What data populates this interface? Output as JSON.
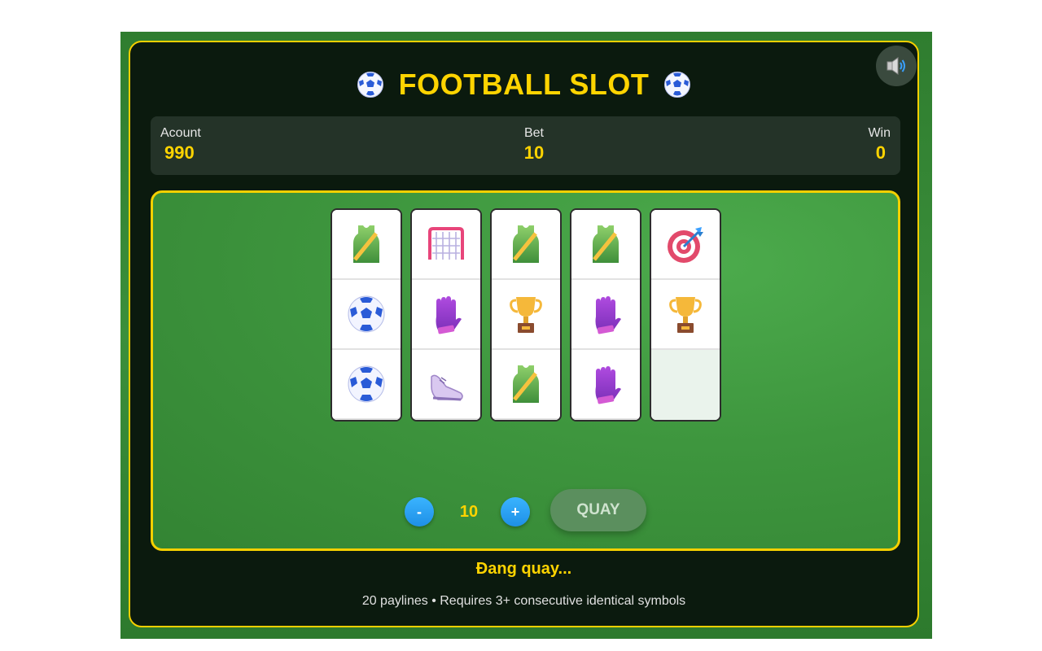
{
  "header": {
    "title": "FOOTBALL SLOT",
    "title_icon": "soccer-ball-icon",
    "sound_icon": "speaker-icon"
  },
  "stats": {
    "account_label": "Acount",
    "account_value": "990",
    "bet_label": "Bet",
    "bet_value": "10",
    "win_label": "Win",
    "win_value": "0"
  },
  "reels": [
    [
      "jersey",
      "soccer-ball",
      "soccer-ball"
    ],
    [
      "goal-net",
      "goalkeeper-glove",
      "sneaker"
    ],
    [
      "jersey",
      "trophy",
      "jersey"
    ],
    [
      "jersey",
      "goalkeeper-glove",
      "goalkeeper-glove"
    ],
    [
      "target",
      "trophy",
      "empty"
    ]
  ],
  "controls": {
    "minus_label": "-",
    "plus_label": "+",
    "bet_amount": "10",
    "spin_label": "QUAY"
  },
  "status_text": "Đang quay...",
  "footer_note": "20 paylines • Requires 3+ consecutive identical symbols",
  "colors": {
    "accent": "#ffd400",
    "cabinet": "#0b1a0e",
    "field": "#3e963e",
    "button_blue": "#1e90e6"
  }
}
